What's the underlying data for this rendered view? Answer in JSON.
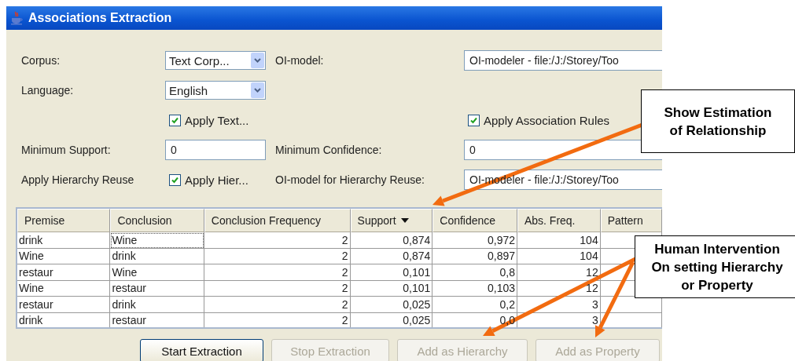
{
  "window": {
    "title": "Associations Extraction"
  },
  "form": [
    {
      "label": "Corpus:",
      "control": {
        "kind": "combo",
        "value": "Text Corp..."
      },
      "label_2": "OI-model:",
      "control_2": {
        "kind": "field",
        "value": "OI-modeler - file:/J:/Storey/Too"
      }
    },
    {
      "label": "Language:",
      "control": {
        "kind": "combo",
        "value": "English"
      }
    },
    {
      "control": {
        "kind": "checkbox",
        "label": "Apply Text...",
        "checked": true
      },
      "control_2": {
        "kind": "checkbox",
        "label": "Apply Association Rules",
        "checked": true
      }
    },
    {
      "label": "Minimum Support:",
      "control": {
        "kind": "field",
        "value": "0"
      },
      "label_2": "Minimum Confidence:",
      "control_2": {
        "kind": "field",
        "value": "0"
      }
    },
    {
      "label": "Apply Hierarchy Reuse",
      "control": {
        "kind": "checkbox",
        "label": "Apply Hier...",
        "checked": true
      },
      "label_2": "OI-model for Hierarchy Reuse:",
      "control_2": {
        "kind": "field",
        "value": "OI-modeler - file:/J:/Storey/Too"
      }
    }
  ],
  "table": {
    "columns": [
      {
        "label": "Premise",
        "sorted": false
      },
      {
        "label": "Conclusion",
        "sorted": false
      },
      {
        "label": "Conclusion Frequency",
        "sorted": false
      },
      {
        "label": "Support",
        "sorted": true
      },
      {
        "label": "Confidence",
        "sorted": false
      },
      {
        "label": "Abs. Freq.",
        "sorted": false
      },
      {
        "label": "Pattern",
        "sorted": false
      }
    ],
    "rows": [
      {
        "cells": [
          {
            "text": "drink",
            "focused": false
          },
          {
            "text": "Wine",
            "focused": true
          },
          {
            "text": "2",
            "focused": false
          },
          {
            "text": "0,874",
            "focused": false
          },
          {
            "text": "0,972",
            "focused": false
          },
          {
            "text": "104",
            "focused": false
          }
        ]
      },
      {
        "cells": [
          {
            "text": "Wine",
            "focused": false
          },
          {
            "text": "drink",
            "focused": false
          },
          {
            "text": "2",
            "focused": false
          },
          {
            "text": "0,874",
            "focused": false
          },
          {
            "text": "0,897",
            "focused": false
          },
          {
            "text": "104",
            "focused": false
          }
        ]
      },
      {
        "cells": [
          {
            "text": "restaur",
            "focused": false
          },
          {
            "text": "Wine",
            "focused": false
          },
          {
            "text": "2",
            "focused": false
          },
          {
            "text": "0,101",
            "focused": false
          },
          {
            "text": "0,8",
            "focused": false
          },
          {
            "text": "12",
            "focused": false
          }
        ]
      },
      {
        "cells": [
          {
            "text": "Wine",
            "focused": false
          },
          {
            "text": "restaur",
            "focused": false
          },
          {
            "text": "2",
            "focused": false
          },
          {
            "text": "0,101",
            "focused": false
          },
          {
            "text": "0,103",
            "focused": false
          },
          {
            "text": "12",
            "focused": false
          }
        ]
      },
      {
        "cells": [
          {
            "text": "restaur",
            "focused": false
          },
          {
            "text": "drink",
            "focused": false
          },
          {
            "text": "2",
            "focused": false
          },
          {
            "text": "0,025",
            "focused": false
          },
          {
            "text": "0,2",
            "focused": false
          },
          {
            "text": "3",
            "focused": false
          }
        ]
      },
      {
        "cells": [
          {
            "text": "drink",
            "focused": false
          },
          {
            "text": "restaur",
            "focused": false
          },
          {
            "text": "2",
            "focused": false
          },
          {
            "text": "0,025",
            "focused": false
          },
          {
            "text": "0,0",
            "focused": false
          },
          {
            "text": "3",
            "focused": false
          }
        ]
      }
    ]
  },
  "buttons": [
    {
      "label": "Start Extraction",
      "disabled": false
    },
    {
      "label": "Stop Extraction",
      "disabled": true
    },
    {
      "label": "Add as Hierarchy",
      "disabled": true
    },
    {
      "label": "Add as Property",
      "disabled": true
    }
  ],
  "annotations": [
    {
      "lines": [
        "Show Estimation",
        "of Relationship"
      ]
    },
    {
      "lines": [
        "Human Intervention",
        "On setting Hierarchy",
        "or Property"
      ]
    }
  ]
}
